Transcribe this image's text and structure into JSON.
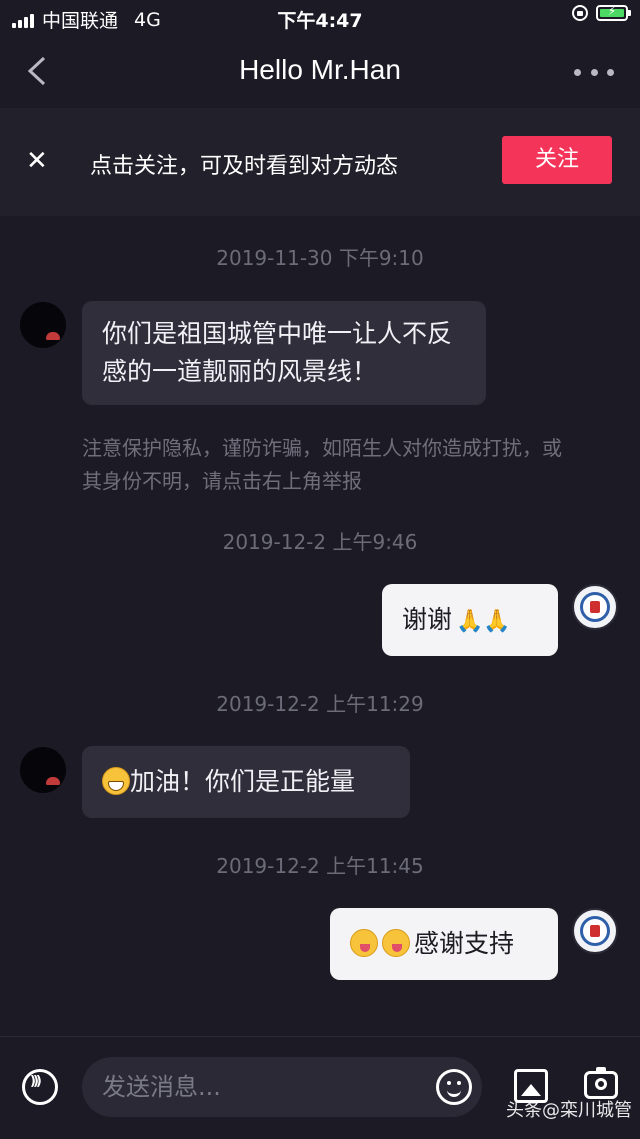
{
  "status_bar": {
    "carrier": "中国联通",
    "network": "4G",
    "time": "下午4:47"
  },
  "nav": {
    "title": "Hello Mr.Han"
  },
  "follow_banner": {
    "text": "点击关注，可及时看到对方动态",
    "button": "关注",
    "accent_color": "#f5345a"
  },
  "messages": [
    {
      "timestamp": "2019-11-30 下午9:10",
      "side": "left",
      "text": "你们是祖国城管中唯一让人不反感的一道靓丽的风景线！"
    },
    {
      "note": "注意保护隐私，谨防诈骗，如陌生人对你造成打扰，或其身份不明，请点击右上角举报"
    },
    {
      "timestamp": "2019-12-2 上午9:46",
      "side": "right",
      "text": "谢谢",
      "emoji": "pray-hands"
    },
    {
      "timestamp": "2019-12-2 上午11:29",
      "side": "left",
      "text": "加油！你们是正能量",
      "emoji": "grin"
    },
    {
      "timestamp": "2019-12-2 上午11:45",
      "side": "right",
      "text": "感谢支持",
      "emoji": "wink-tongue"
    }
  ],
  "input_bar": {
    "placeholder": "发送消息..."
  },
  "watermark": "头条@栾川城管"
}
